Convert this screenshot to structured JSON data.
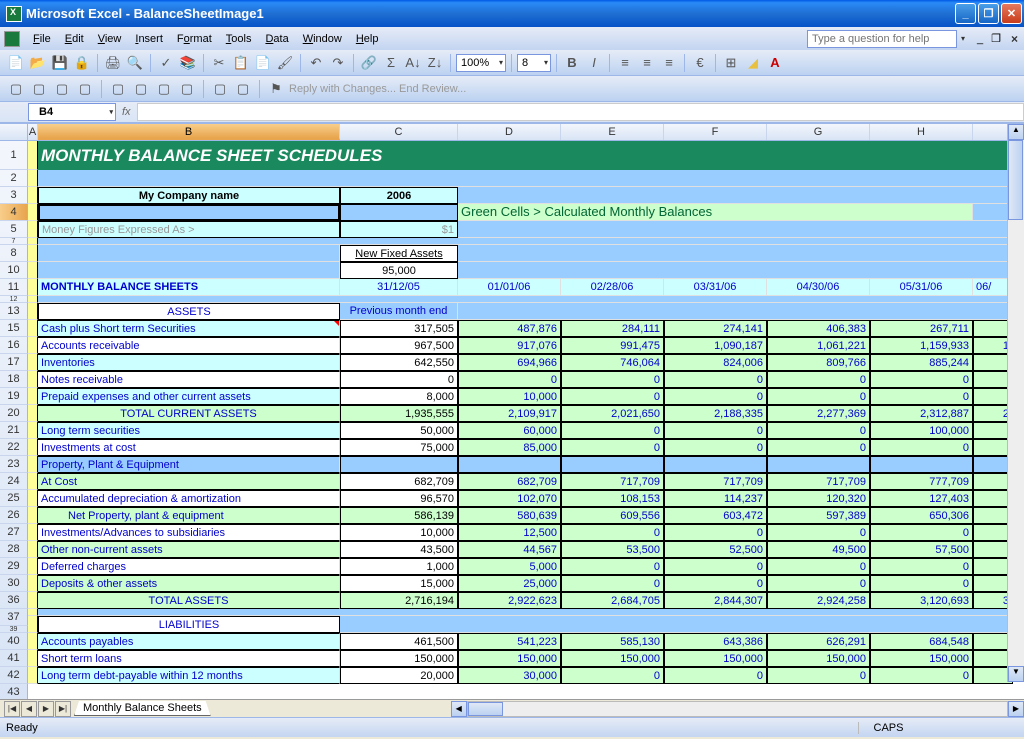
{
  "window": {
    "title": "Microsoft Excel - BalanceSheetImage1"
  },
  "menu": {
    "file": "File",
    "edit": "Edit",
    "view": "View",
    "insert": "Insert",
    "format": "Format",
    "tools": "Tools",
    "data": "Data",
    "window": "Window",
    "help": "Help",
    "help_placeholder": "Type a question for help"
  },
  "toolbar": {
    "zoom": "100%",
    "font_size": "8",
    "reply": "Reply with Changes...",
    "end_review": "End Review..."
  },
  "namebox": "B4",
  "cols": {
    "A": "A",
    "B": "B",
    "C": "C",
    "D": "D",
    "E": "E",
    "F": "F",
    "G": "G",
    "H": "H"
  },
  "rows_labels": [
    "1",
    "2",
    "3",
    "4",
    "5",
    "7",
    "8",
    "10",
    "11",
    "12",
    "13",
    "15",
    "16",
    "17",
    "18",
    "19",
    "20",
    "21",
    "22",
    "23",
    "24",
    "25",
    "26",
    "27",
    "28",
    "29",
    "30",
    "36",
    "37",
    "39",
    "40",
    "41",
    "42",
    "43"
  ],
  "sheet": {
    "title": "MONTHLY BALANCE SHEET SCHEDULES",
    "company": "My Company name",
    "year": "2006",
    "legend": "Green Cells > Calculated Monthly Balances",
    "money_label": "Money Figures Expressed As >",
    "money_value": "$1",
    "new_fixed_assets": "New Fixed Assets",
    "new_fixed_assets_val": "95,000",
    "section_heading": "MONTHLY BALANCE SHEETS",
    "prev_month": "Previous month end",
    "assets_hdr": "ASSETS",
    "liabilities_hdr": "LIABILITIES",
    "dates": [
      "31/12/05",
      "01/01/06",
      "02/28/06",
      "03/31/06",
      "04/30/06",
      "05/31/06",
      "06/"
    ],
    "rows": {
      "cash": {
        "label": "Cash plus Short term Securities",
        "v": [
          "317,505",
          "487,876",
          "284,111",
          "274,141",
          "406,383",
          "267,711",
          ""
        ]
      },
      "ar": {
        "label": "Accounts receivable",
        "v": [
          "967,500",
          "917,076",
          "991,475",
          "1,090,187",
          "1,061,221",
          "1,159,933",
          "1"
        ]
      },
      "inv": {
        "label": "Inventories",
        "v": [
          "642,550",
          "694,966",
          "746,064",
          "824,006",
          "809,766",
          "885,244",
          ""
        ]
      },
      "notes": {
        "label": "Notes receivable",
        "v": [
          "0",
          "0",
          "0",
          "0",
          "0",
          "0",
          ""
        ]
      },
      "prep": {
        "label": "Prepaid expenses and other current assets",
        "v": [
          "8,000",
          "10,000",
          "0",
          "0",
          "0",
          "0",
          ""
        ]
      },
      "tca": {
        "label": "TOTAL CURRENT ASSETS",
        "v": [
          "1,935,555",
          "2,109,917",
          "2,021,650",
          "2,188,335",
          "2,277,369",
          "2,312,887",
          "2"
        ]
      },
      "lts": {
        "label": "Long term securities",
        "v": [
          "50,000",
          "60,000",
          "0",
          "0",
          "0",
          "100,000",
          ""
        ]
      },
      "invc": {
        "label": "Investments at cost",
        "v": [
          "75,000",
          "85,000",
          "0",
          "0",
          "0",
          "0",
          ""
        ]
      },
      "ppe": {
        "label": "Property, Plant & Equipment",
        "v": [
          "",
          "",
          "",
          "",
          "",
          "",
          ""
        ]
      },
      "atcost": {
        "label": "At Cost",
        "v": [
          "682,709",
          "682,709",
          "717,709",
          "717,709",
          "717,709",
          "777,709",
          ""
        ]
      },
      "accdep": {
        "label": "Accumulated depreciation & amortization",
        "v": [
          "96,570",
          "102,070",
          "108,153",
          "114,237",
          "120,320",
          "127,403",
          ""
        ]
      },
      "netppe": {
        "label": "Net Property, plant & equipment",
        "v": [
          "586,139",
          "580,639",
          "609,556",
          "603,472",
          "597,389",
          "650,306",
          ""
        ]
      },
      "invadv": {
        "label": "Investments/Advances to subsidiaries",
        "v": [
          "10,000",
          "12,500",
          "0",
          "0",
          "0",
          "0",
          ""
        ]
      },
      "onca": {
        "label": "Other non-current assets",
        "v": [
          "43,500",
          "44,567",
          "53,500",
          "52,500",
          "49,500",
          "57,500",
          ""
        ]
      },
      "defc": {
        "label": "Deferred charges",
        "v": [
          "1,000",
          "5,000",
          "0",
          "0",
          "0",
          "0",
          ""
        ]
      },
      "depo": {
        "label": "Deposits & other assets",
        "v": [
          "15,000",
          "25,000",
          "0",
          "0",
          "0",
          "0",
          ""
        ]
      },
      "ta": {
        "label": "TOTAL ASSETS",
        "v": [
          "2,716,194",
          "2,922,623",
          "2,684,705",
          "2,844,307",
          "2,924,258",
          "3,120,693",
          "3"
        ]
      },
      "ap": {
        "label": "Accounts payables",
        "v": [
          "461,500",
          "541,223",
          "585,130",
          "643,386",
          "626,291",
          "684,548",
          ""
        ]
      },
      "stl": {
        "label": "Short term loans",
        "v": [
          "150,000",
          "150,000",
          "150,000",
          "150,000",
          "150,000",
          "150,000",
          ""
        ]
      },
      "ltd": {
        "label": "Long term debt-payable within 12 months",
        "v": [
          "20,000",
          "30,000",
          "0",
          "0",
          "0",
          "0",
          ""
        ]
      }
    }
  },
  "tabs": {
    "sheet1": "Monthly Balance Sheets"
  },
  "status": {
    "ready": "Ready",
    "caps": "CAPS"
  }
}
